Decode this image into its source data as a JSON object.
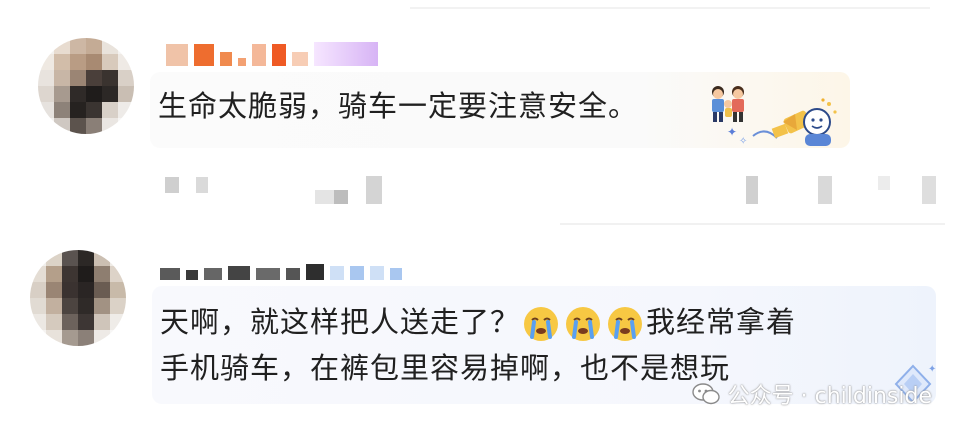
{
  "comments": [
    {
      "text": "生命太脆弱，骑车一定要注意安全。",
      "sticker_icon": "family-sticker-icon",
      "decoration_icon": "cheering-character-icon"
    },
    {
      "line1": "天啊，就这样把人送走了？",
      "emoji_icon": "crying-face-icon",
      "line1_end": "我经常拿着",
      "line2": "手机骑车，在裤包里容易掉啊，也不是想玩",
      "decoration_icon": "diamond-badge-icon"
    }
  ],
  "watermark": {
    "text": "公众号 · childinside",
    "icon": "wechat-icon"
  },
  "colors": {
    "text": "#202020",
    "bubble1_tint": "#fdf6e8",
    "bubble2_tint": "#eef3fc"
  }
}
